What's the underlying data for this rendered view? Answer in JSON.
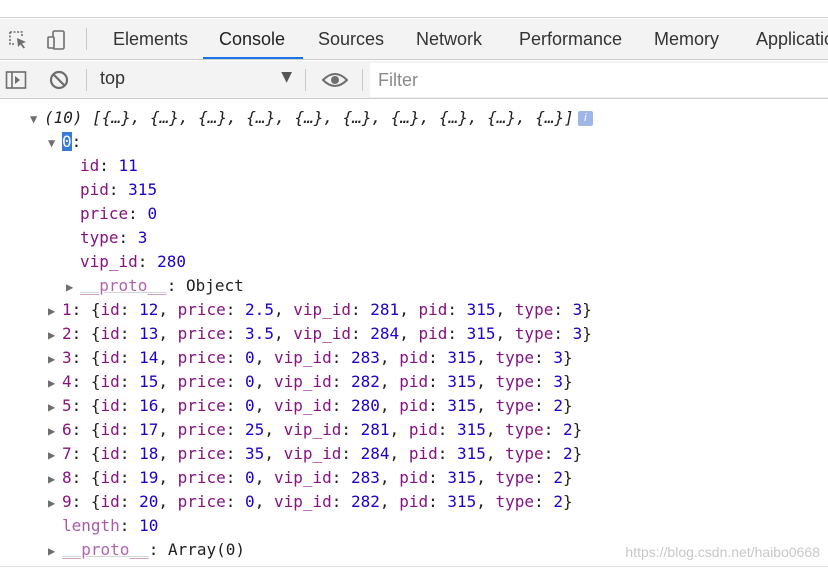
{
  "tabs": [
    {
      "label": "Elements",
      "active": false
    },
    {
      "label": "Console",
      "active": true
    },
    {
      "label": "Sources",
      "active": false
    },
    {
      "label": "Network",
      "active": false
    },
    {
      "label": "Performance",
      "active": false
    },
    {
      "label": "Memory",
      "active": false
    },
    {
      "label": "Applicatio",
      "active": false
    }
  ],
  "toolbar": {
    "context": "top",
    "filter_placeholder": "Filter",
    "icons": [
      "sidebar-toggle-icon",
      "clear-console-icon",
      "eye-icon"
    ]
  },
  "console": {
    "array_length_prefix": "(10)",
    "array_preview": "[{…}, {…}, {…}, {…}, {…}, {…}, {…}, {…}, {…}, {…}]",
    "expanded_index": "0",
    "expanded_props": [
      {
        "key": "id",
        "value": "11"
      },
      {
        "key": "pid",
        "value": "315"
      },
      {
        "key": "price",
        "value": "0"
      },
      {
        "key": "type",
        "value": "3"
      },
      {
        "key": "vip_id",
        "value": "280"
      }
    ],
    "expanded_proto_key": "__proto__",
    "expanded_proto_value": "Object",
    "items": [
      {
        "index": "1",
        "id": "12",
        "price": "2.5",
        "vip_id": "281",
        "pid": "315",
        "type": "3"
      },
      {
        "index": "2",
        "id": "13",
        "price": "3.5",
        "vip_id": "284",
        "pid": "315",
        "type": "3"
      },
      {
        "index": "3",
        "id": "14",
        "price": "0",
        "vip_id": "283",
        "pid": "315",
        "type": "3"
      },
      {
        "index": "4",
        "id": "15",
        "price": "0",
        "vip_id": "282",
        "pid": "315",
        "type": "3"
      },
      {
        "index": "5",
        "id": "16",
        "price": "0",
        "vip_id": "280",
        "pid": "315",
        "type": "2"
      },
      {
        "index": "6",
        "id": "17",
        "price": "25",
        "vip_id": "281",
        "pid": "315",
        "type": "2"
      },
      {
        "index": "7",
        "id": "18",
        "price": "35",
        "vip_id": "284",
        "pid": "315",
        "type": "2"
      },
      {
        "index": "8",
        "id": "19",
        "price": "0",
        "vip_id": "283",
        "pid": "315",
        "type": "2"
      },
      {
        "index": "9",
        "id": "20",
        "price": "0",
        "vip_id": "282",
        "pid": "315",
        "type": "2"
      }
    ],
    "length_key": "length",
    "length_value": "10",
    "array_proto_key": "__proto__",
    "array_proto_value": "Array(0)"
  },
  "watermark": "https://blog.csdn.net/haibo0668",
  "colors": {
    "key": "#881280",
    "number": "#1c00cf",
    "accent": "#1a73e8"
  }
}
